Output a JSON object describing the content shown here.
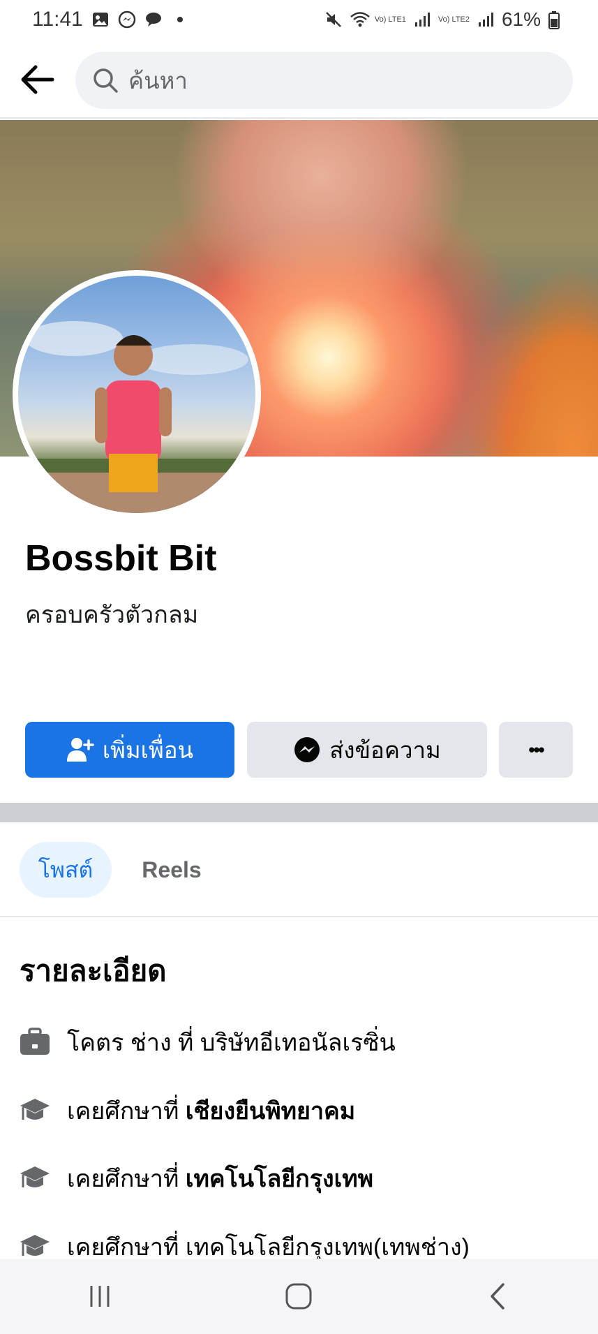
{
  "status_bar": {
    "time": "11:41",
    "battery": "61%",
    "net1": "Vo) LTE1",
    "net2": "Vo) LTE2",
    "icons": [
      "gallery-icon",
      "messenger-icon",
      "chat-icon",
      "dot-icon",
      "mute-icon",
      "wifi-icon",
      "signal-icon",
      "battery-icon"
    ]
  },
  "header": {
    "search_placeholder": "ค้นหา"
  },
  "profile": {
    "name": "Bossbit Bit",
    "bio": "ครอบครัวตัวกลม"
  },
  "actions": {
    "add_friend": "เพิ่มเพื่อน",
    "message": "ส่งข้อความ",
    "more": "•••"
  },
  "tabs": {
    "posts": "โพสต์",
    "reels": "Reels"
  },
  "details": {
    "title": "รายละเอียด",
    "items": [
      {
        "icon": "briefcase-icon",
        "text": "โคตร ช่าง ที่ บริษัทอีเทอนัลเรซิ่น",
        "bold": ""
      },
      {
        "icon": "graduation-cap-icon",
        "text": "เคยศึกษาที่ ",
        "bold": "เชียงยืนพิทยาคม"
      },
      {
        "icon": "graduation-cap-icon",
        "text": "เคยศึกษาที่ ",
        "bold": "เทคโนโลยีกรุงเทพ"
      },
      {
        "icon": "graduation-cap-icon",
        "text": "เคยศึกษาที่ เทคโนโลยีกรุงเทพ(เทพช่าง)",
        "bold": ""
      }
    ]
  },
  "colors": {
    "primary": "#1b74e4",
    "tab_active_bg": "#e7f3ff",
    "button_gray": "#e4e6eb",
    "divider": "#ccd0d5"
  }
}
